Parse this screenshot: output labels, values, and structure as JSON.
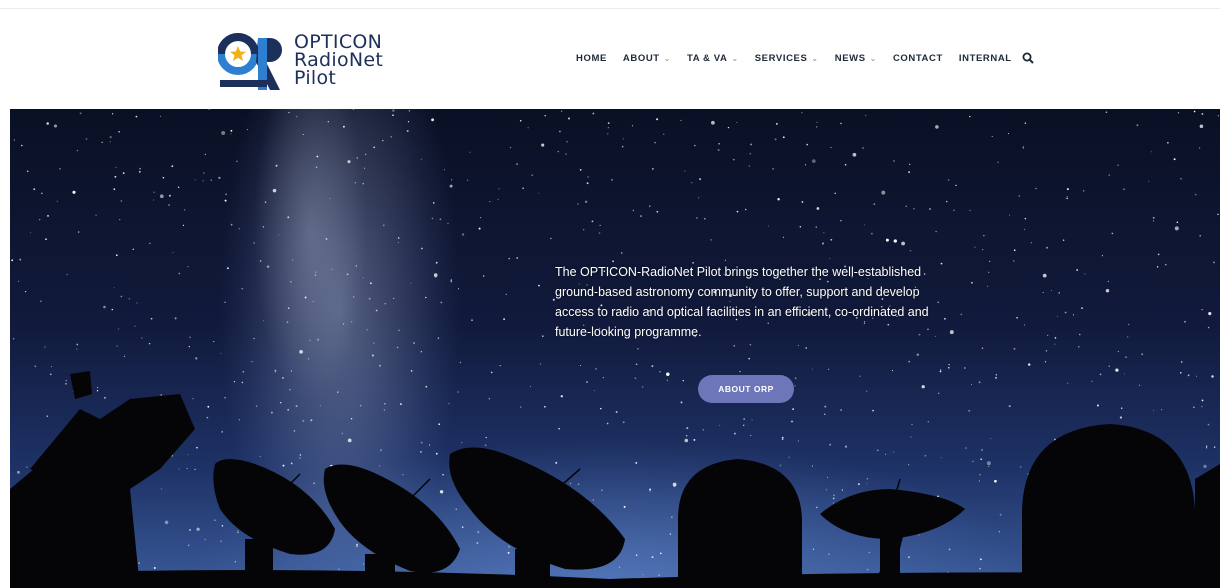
{
  "colors": {
    "brand_dark": "#1d2f5b",
    "brand_blue": "#2f7fd0",
    "nav_text": "#1e2a3a",
    "button_bg": "#6c76b8"
  },
  "logo": {
    "line1": "OPTICON",
    "line2": "RadioNet",
    "line3": "Pilot"
  },
  "nav": {
    "items": [
      {
        "label": "HOME"
      },
      {
        "label": "ABOUT",
        "caret": "⌄"
      },
      {
        "label": "TA & VA",
        "caret": "⌄"
      },
      {
        "label": "SERVICES",
        "caret": "⌄"
      },
      {
        "label": "NEWS",
        "caret": "⌄"
      },
      {
        "label": "CONTACT"
      },
      {
        "label": "INTERNAL"
      }
    ],
    "search_icon": "search-icon"
  },
  "hero": {
    "text": "The OPTICON-RadioNet Pilot brings together the well-established ground-based astronomy community to offer, support and develop access to radio and optical facilities in an efficient, co-ordinated and future-looking programme.",
    "button_label": "ABOUT ORP"
  }
}
